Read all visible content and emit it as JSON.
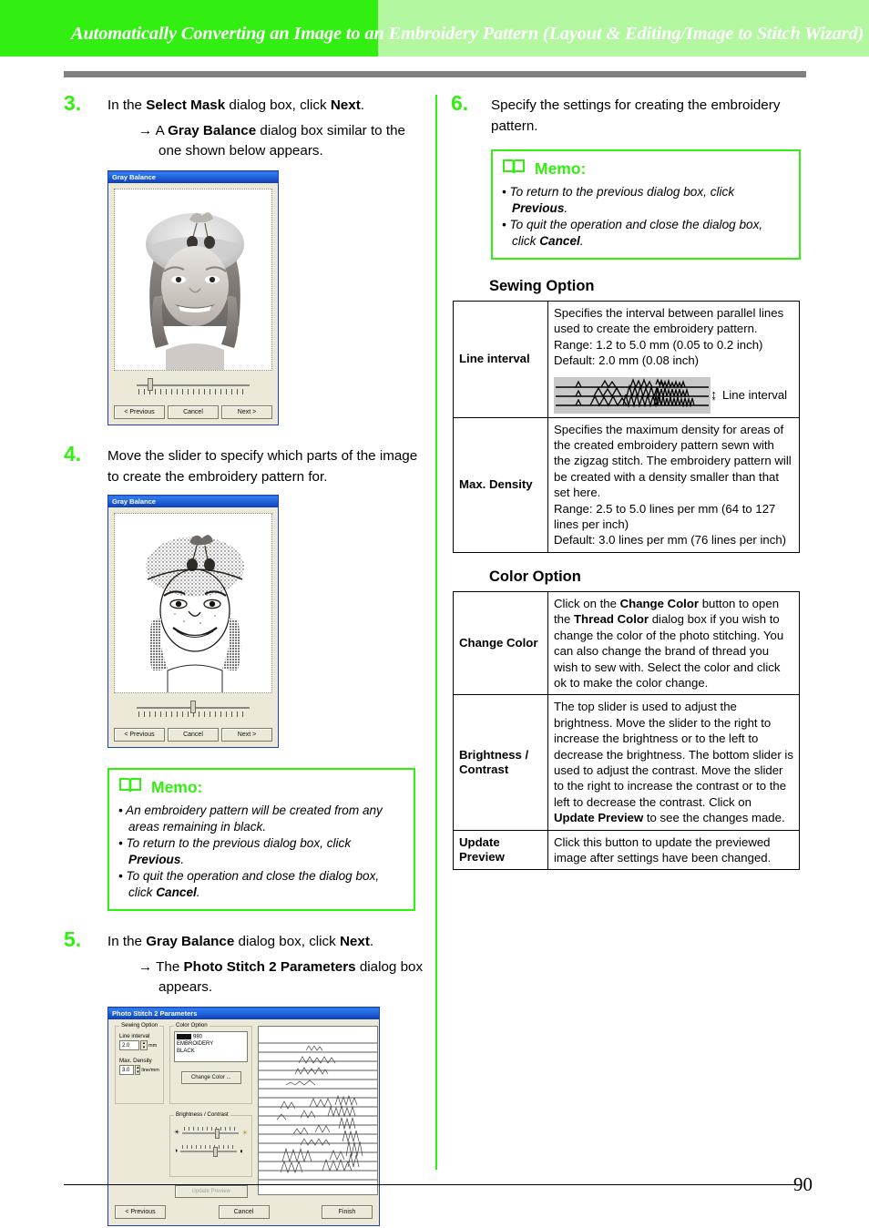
{
  "header": {
    "title": "Automatically Converting an Image to an Embroidery Pattern (Layout & Editing/Image to Stitch Wizard)",
    "band_dark_color": "#33ee11",
    "band_light_color": "#b3f7a0",
    "rule_color": "#808080"
  },
  "footer": {
    "page_number": "90"
  },
  "left_column": {
    "step3": {
      "number": "3.",
      "text_parts": [
        "In the ",
        "Select Mask",
        " dialog box, click ",
        "Next",
        "."
      ],
      "sub_arrow": "→",
      "sub_parts": [
        "A ",
        "Gray Balance",
        " dialog box similar to the one shown below appears."
      ]
    },
    "dialog_gray_balance_1": {
      "title": "Gray Balance",
      "buttons": [
        "< Previous",
        "Cancel",
        "Next >"
      ],
      "slider_position_percent": 10
    },
    "step4": {
      "number": "4.",
      "text": "Move the slider to specify which parts of the image to create the embroidery pattern for."
    },
    "dialog_gray_balance_2": {
      "title": "Gray Balance",
      "buttons": [
        "< Previous",
        "Cancel",
        "Next >"
      ],
      "slider_position_percent": 50
    },
    "memo": {
      "icon": "book-icon",
      "title": "Memo:",
      "items": [
        {
          "parts": [
            "An embroidery pattern will be created from any areas remaining in black."
          ]
        },
        {
          "parts": [
            "To return to the previous dialog box, click ",
            "Previous",
            "."
          ]
        },
        {
          "parts": [
            "To quit the operation and close the dialog box, click ",
            "Cancel",
            "."
          ]
        }
      ]
    },
    "step5": {
      "number": "5.",
      "text_parts": [
        "In the ",
        "Gray Balance",
        " dialog box, click ",
        "Next",
        "."
      ],
      "sub_arrow": "→",
      "sub_parts": [
        "The ",
        "Photo Stitch 2 Parameters",
        " dialog box appears."
      ]
    },
    "dialog_photo_stitch": {
      "title": "Photo Stitch 2 Parameters",
      "sewing_option_caption": "Sewing Option",
      "line_interval_label": "Line interval",
      "line_interval_value": "2.0",
      "line_interval_unit": "mm",
      "max_density_label": "Max. Density",
      "max_density_value": "3.0",
      "max_density_unit": "line/mm",
      "color_option_caption": "Color Option",
      "thread_code": "980",
      "thread_brand": "EMBROIDERY",
      "thread_color_name": "BLACK",
      "change_color_button": "Change Color ...",
      "brightness_contrast_caption": "Brightness / Contrast",
      "update_preview_button": "Update Preview",
      "buttons": [
        "< Previous",
        "Cancel",
        "Finish"
      ]
    }
  },
  "right_column": {
    "step6": {
      "number": "6.",
      "text": "Specify the settings for creating the embroidery pattern."
    },
    "memo": {
      "icon": "book-icon",
      "title": "Memo:",
      "items": [
        {
          "parts": [
            "To return to the previous dialog box, click ",
            "Previous",
            "."
          ]
        },
        {
          "parts": [
            "To quit the operation and close the dialog box, click ",
            "Cancel",
            "."
          ]
        }
      ]
    },
    "sewing_option": {
      "heading": "Sewing Option",
      "rows": [
        {
          "term": "Line interval",
          "lines": [
            "Specifies the interval between parallel lines used to create the embroidery pattern.",
            "Range: 1.2 to 5.0 mm (0.05 to 0.2 inch)",
            "Default: 2.0 mm (0.08 inch)"
          ],
          "illustration_label": "Line interval",
          "illustration_arrow": "↨"
        },
        {
          "term": "Max. Density",
          "lines": [
            "Specifies the maximum density for areas of the created embroidery pattern sewn with the zigzag stitch. The embroidery pattern will be created with a density smaller than that set here.",
            "Range: 2.5 to 5.0 lines per mm (64 to 127 lines per inch)",
            "Default: 3.0 lines per mm (76 lines per inch)"
          ]
        }
      ]
    },
    "color_option": {
      "heading": "Color Option",
      "rows": [
        {
          "term": "Change Color",
          "parts": [
            "Click on the ",
            "Change Color",
            " button to open the ",
            "Thread Color",
            " dialog box if you wish to change the color of the photo stitching. You can also change the brand of thread you wish to sew with. Select the color and click ok to make the color change."
          ]
        },
        {
          "term": "Brightness / Contrast",
          "parts": [
            "The top slider is used to adjust the brightness. Move the slider to the right to increase the brightness or to the left to decrease the brightness. The bottom slider is used to adjust the contrast. Move the slider to the right to increase the contrast or to the left to decrease the contrast. Click on ",
            "Update Preview",
            " to see the changes made."
          ]
        },
        {
          "term": "Update Preview",
          "parts": [
            "Click this button to update the previewed image after settings have been changed."
          ]
        }
      ]
    }
  }
}
